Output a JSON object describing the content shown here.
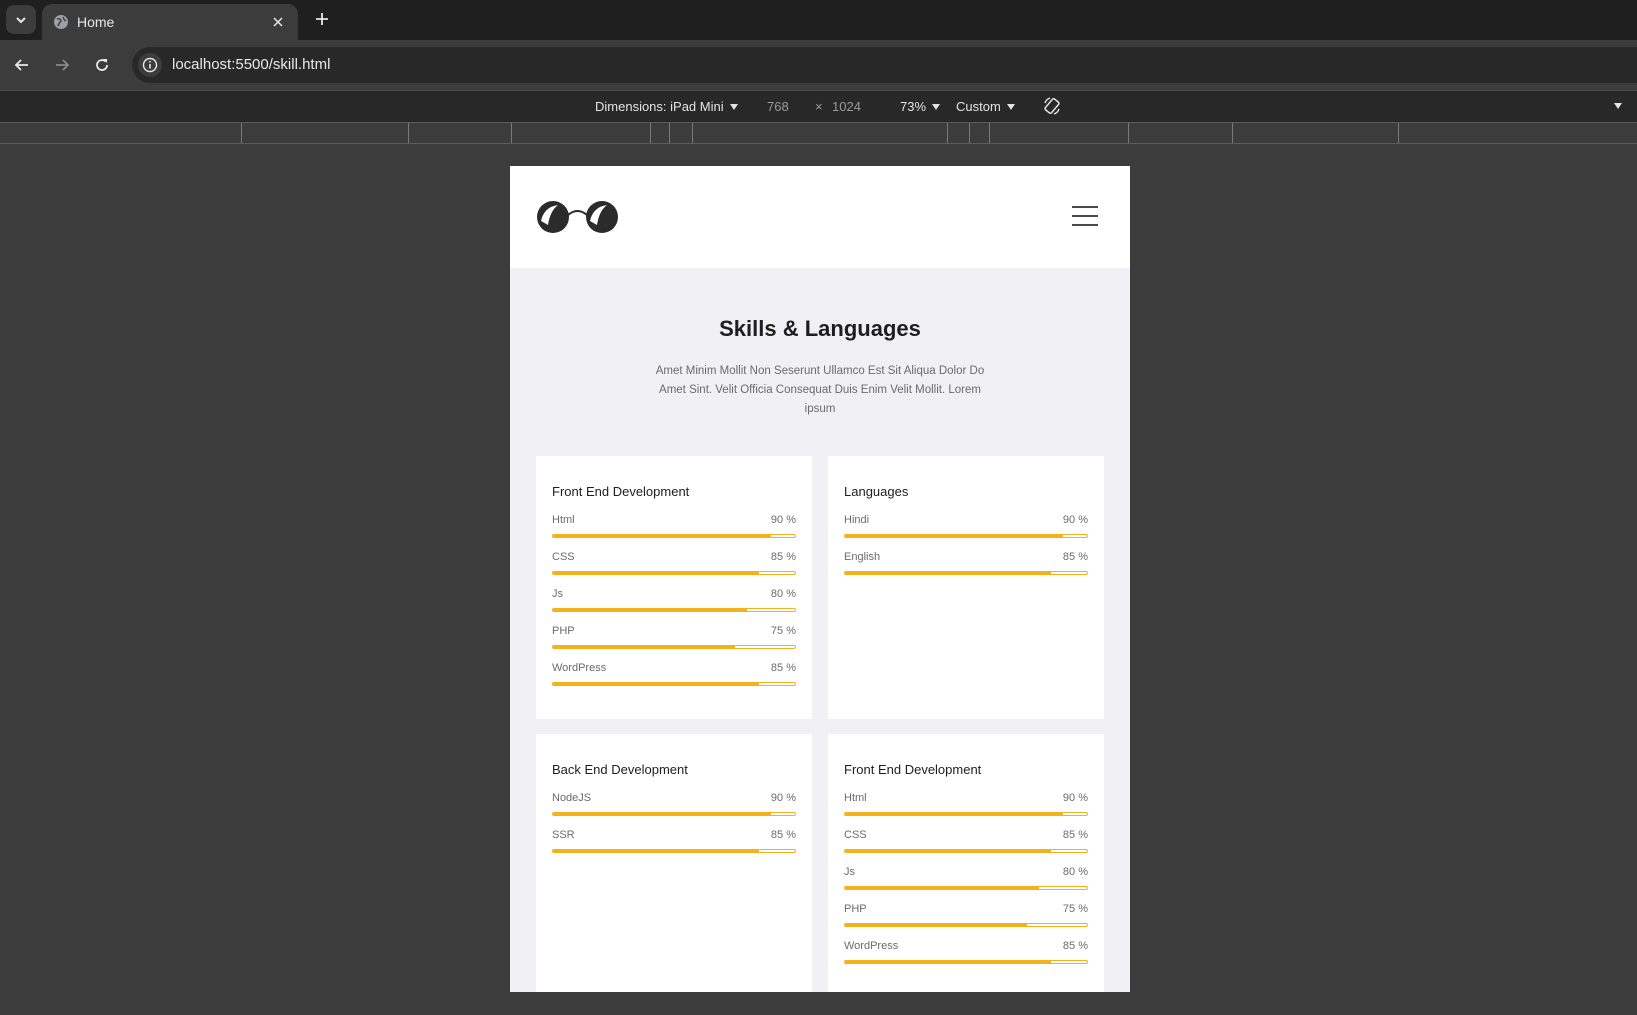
{
  "browser": {
    "tab_title": "Home",
    "url": "localhost:5500/skill.html"
  },
  "devtools": {
    "dimensions_label": "Dimensions: iPad Mini",
    "width": "768",
    "times": "×",
    "height": "1024",
    "zoom": "73%",
    "throttle": "Custom"
  },
  "page": {
    "title": "Skills & Languages",
    "description": "Amet Minim Mollit Non Seserunt Ullamco Est Sit Aliqua Dolor Do Amet Sint. Velit Officia Consequat Duis Enim Velit Mollit. Lorem ipsum",
    "cards": [
      {
        "title": "Front End Development",
        "skills": [
          {
            "name": "Html",
            "label": "90 %",
            "value": 90
          },
          {
            "name": "CSS",
            "label": "85 %",
            "value": 85
          },
          {
            "name": "Js",
            "label": "80 %",
            "value": 80
          },
          {
            "name": "PHP",
            "label": "75 %",
            "value": 75
          },
          {
            "name": "WordPress",
            "label": "85 %",
            "value": 85
          }
        ]
      },
      {
        "title": "Languages",
        "skills": [
          {
            "name": "Hindi",
            "label": "90 %",
            "value": 90
          },
          {
            "name": "English",
            "label": "85 %",
            "value": 85
          }
        ]
      },
      {
        "title": "Back End Development",
        "skills": [
          {
            "name": "NodeJS",
            "label": "90 %",
            "value": 90
          },
          {
            "name": "SSR",
            "label": "85 %",
            "value": 85
          }
        ]
      },
      {
        "title": "Front End Development",
        "skills": [
          {
            "name": "Html",
            "label": "90 %",
            "value": 90
          },
          {
            "name": "CSS",
            "label": "85 %",
            "value": 85
          },
          {
            "name": "Js",
            "label": "80 %",
            "value": 80
          },
          {
            "name": "PHP",
            "label": "75 %",
            "value": 75
          },
          {
            "name": "WordPress",
            "label": "85 %",
            "value": 85
          }
        ]
      }
    ]
  },
  "colors": {
    "accent": "#f5b11c",
    "page_bg": "#f1f0f5"
  }
}
